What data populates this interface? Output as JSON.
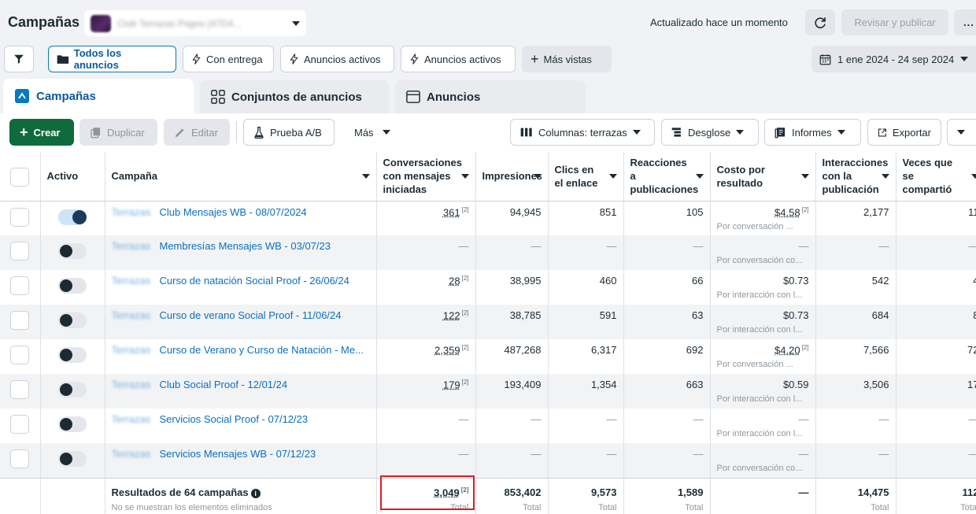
{
  "header": {
    "title": "Campañas",
    "account_name": "Club Terrazas Pagos (47D4...",
    "updated": "Actualizado hace un momento",
    "review_label": "Revisar y publicar",
    "more_label": "..."
  },
  "filters": {
    "all_ads": "Todos los anuncios",
    "delivering": "Con entrega",
    "active_ads_1": "Anuncios activos",
    "active_ads_2": "Anuncios activos",
    "more_views": "Más vistas",
    "date_range": "1 ene 2024 - 24 sep 2024"
  },
  "tabs": {
    "campaigns": "Campañas",
    "adsets": "Conjuntos de anuncios",
    "ads": "Anuncios"
  },
  "toolbar": {
    "create": "Crear",
    "duplicate": "Duplicar",
    "edit": "Editar",
    "ab_test": "Prueba A/B",
    "more": "Más",
    "columns": "Columnas: terrazas",
    "breakdown": "Desglose",
    "reports": "Informes",
    "export": "Exportar"
  },
  "columns": {
    "active": "Activo",
    "campaign": "Campaña",
    "conversations": "Conversaciones con mensajes iniciadas",
    "impressions": "Impresiones",
    "link_clicks": "Clics en el enlace",
    "reactions": "Reacciones a publicaciones",
    "cost_per_result": "Costo por resultado",
    "interactions": "Interacciones con la publicación",
    "shares": "Veces que se compartió"
  },
  "rows": [
    {
      "on": true,
      "prefix": "Terrazas",
      "name": "Club Mensajes WB - 08/07/2024",
      "conv": "361",
      "impr": "94,945",
      "clicks": "851",
      "react": "105",
      "cost": "$4.58",
      "cost_fn": true,
      "cost_sub": "Por conversación ...",
      "inter": "2,177",
      "shares": "11"
    },
    {
      "on": false,
      "prefix": "Terrazas",
      "name": "Membresías Mensajes WB - 03/07/23",
      "conv": "—",
      "impr": "—",
      "clicks": "—",
      "react": "—",
      "cost": "—",
      "cost_fn": false,
      "cost_sub": "Por conversación co...",
      "inter": "—",
      "shares": "—"
    },
    {
      "on": false,
      "prefix": "Terrazas",
      "name": "Curso de natación Social Proof - 26/06/24",
      "conv": "28",
      "impr": "38,995",
      "clicks": "460",
      "react": "66",
      "cost": "$0.73",
      "cost_fn": false,
      "cost_sub": "Por interacción con l...",
      "inter": "542",
      "shares": "4"
    },
    {
      "on": false,
      "prefix": "Terrazas",
      "name": "Curso de verano Social Proof - 11/06/24",
      "conv": "122",
      "impr": "38,785",
      "clicks": "591",
      "react": "63",
      "cost": "$0.73",
      "cost_fn": false,
      "cost_sub": "Por interacción con l...",
      "inter": "684",
      "shares": "8"
    },
    {
      "on": false,
      "prefix": "Terrazas",
      "name": "Curso de Verano y Curso de Natación - Me...",
      "conv": "2,359",
      "impr": "487,268",
      "clicks": "6,317",
      "react": "692",
      "cost": "$4.20",
      "cost_fn": true,
      "cost_sub": "Por conversación ...",
      "inter": "7,566",
      "shares": "72"
    },
    {
      "on": false,
      "prefix": "Terrazas",
      "name": "Club Social Proof - 12/01/24",
      "conv": "179",
      "impr": "193,409",
      "clicks": "1,354",
      "react": "663",
      "cost": "$0.59",
      "cost_fn": false,
      "cost_sub": "Por interacción con l...",
      "inter": "3,506",
      "shares": "17"
    },
    {
      "on": false,
      "prefix": "Terrazas",
      "name": "Servicios Social Proof - 07/12/23",
      "conv": "—",
      "impr": "—",
      "clicks": "—",
      "react": "—",
      "cost": "—",
      "cost_fn": false,
      "cost_sub": "Por interacción con l...",
      "inter": "—",
      "shares": "—"
    },
    {
      "on": false,
      "prefix": "Terrazas",
      "name": "Servicios Mensajes WB - 07/12/23",
      "conv": "—",
      "impr": "—",
      "clicks": "—",
      "react": "—",
      "cost": "—",
      "cost_fn": false,
      "cost_sub": "Por conversación co...",
      "inter": "—",
      "shares": "—"
    }
  ],
  "footer": {
    "title": "Resultados de 64 campañas",
    "subtitle": "No se muestran los elementos eliminados",
    "conv": "3,049",
    "impr": "853,402",
    "clicks": "9,573",
    "react": "1,589",
    "cost": "—",
    "inter": "14,475",
    "shares": "112",
    "total_label": "Total"
  },
  "footnote_mark": "[2]",
  "colors": {
    "accent": "#0a78be",
    "create_green": "#0f6a3c",
    "highlight_red": "#e01b24"
  }
}
